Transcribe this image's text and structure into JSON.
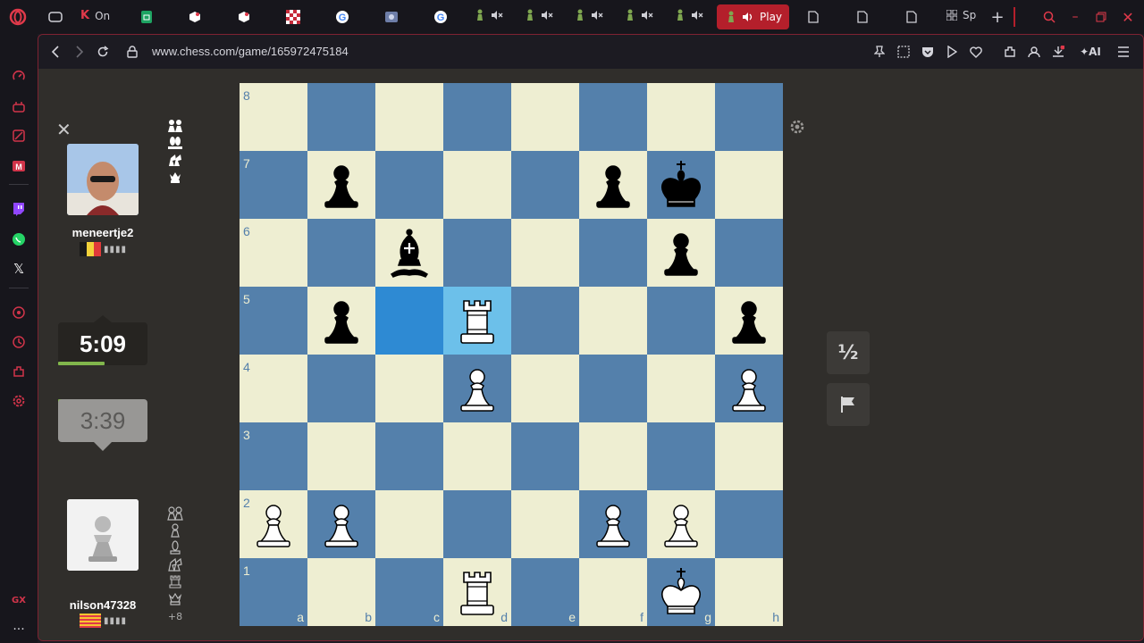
{
  "browser": {
    "tabs": [
      {
        "label": "On",
        "icon": "opera-news-icon"
      },
      {
        "label": "Sp",
        "icon": "grid-icon"
      }
    ],
    "active_tab": {
      "label": "Play",
      "icon": "chess-pawn-icon",
      "audio_icon": "speaker-icon"
    },
    "url": "www.chess.com/game/165972475184"
  },
  "game": {
    "top_player": {
      "name": "meneertje2",
      "flag": "belgium",
      "clock": "5:09"
    },
    "bottom_player": {
      "name": "nilson47328",
      "flag": "catalonia",
      "clock": "3:39"
    },
    "bottom_material_advantage": "+8",
    "draw_button": "½",
    "board": {
      "ranks": [
        "8",
        "7",
        "6",
        "5",
        "4",
        "3",
        "2",
        "1"
      ],
      "files": [
        "a",
        "b",
        "c",
        "d",
        "e",
        "f",
        "g",
        "h"
      ],
      "highlighted": [
        "c5",
        "d5"
      ],
      "pieces": [
        {
          "square": "b7",
          "piece": "black-pawn"
        },
        {
          "square": "f7",
          "piece": "black-pawn"
        },
        {
          "square": "g7",
          "piece": "black-king"
        },
        {
          "square": "c6",
          "piece": "black-bishop"
        },
        {
          "square": "g6",
          "piece": "black-pawn"
        },
        {
          "square": "b5",
          "piece": "black-pawn"
        },
        {
          "square": "h5",
          "piece": "black-pawn"
        },
        {
          "square": "d5",
          "piece": "white-rook"
        },
        {
          "square": "d4",
          "piece": "white-pawn"
        },
        {
          "square": "h4",
          "piece": "white-pawn"
        },
        {
          "square": "a2",
          "piece": "white-pawn"
        },
        {
          "square": "b2",
          "piece": "white-pawn"
        },
        {
          "square": "f2",
          "piece": "white-pawn"
        },
        {
          "square": "g2",
          "piece": "white-pawn"
        },
        {
          "square": "d1",
          "piece": "white-rook"
        },
        {
          "square": "g1",
          "piece": "white-king"
        }
      ]
    }
  }
}
